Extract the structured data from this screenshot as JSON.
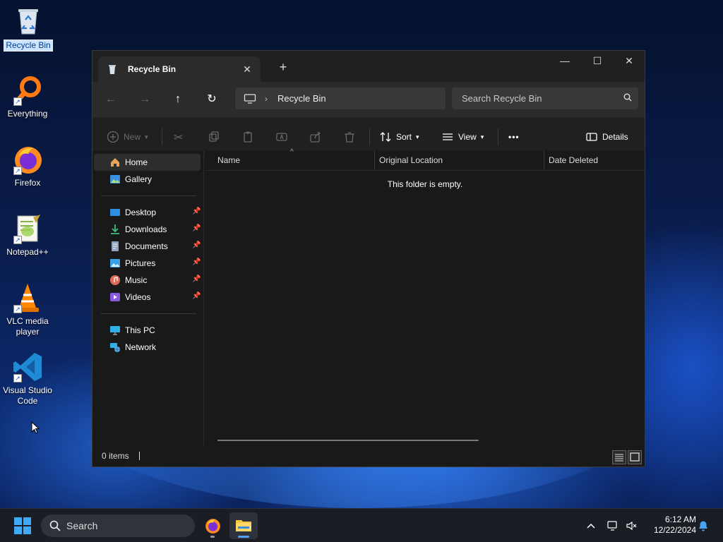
{
  "desktop": {
    "icons": [
      {
        "label": "Recycle Bin",
        "icon": "recycle-bin-icon"
      },
      {
        "label": "Everything",
        "icon": "everything-search-icon"
      },
      {
        "label": "Firefox",
        "icon": "firefox-icon"
      },
      {
        "label": "Notepad++",
        "icon": "notepadpp-icon"
      },
      {
        "label": "VLC media player",
        "icon": "vlc-icon"
      },
      {
        "label": "Visual Studio Code",
        "icon": "vscode-icon"
      }
    ]
  },
  "window": {
    "tab_title": "Recycle Bin",
    "new_tab": "+",
    "controls": {
      "minimize": "—",
      "maximize": "☐",
      "close": "✕"
    },
    "address": {
      "location": "Recycle Bin"
    },
    "search": {
      "placeholder": "Search Recycle Bin"
    },
    "toolbar": {
      "new_label": "New",
      "sort_label": "Sort",
      "view_label": "View",
      "more_label": "•••",
      "details_label": "Details"
    },
    "sidebar": {
      "top": [
        {
          "label": "Home",
          "icon": "home-icon"
        },
        {
          "label": "Gallery",
          "icon": "gallery-icon"
        }
      ],
      "quick_access": [
        {
          "label": "Desktop",
          "icon": "desktop-folder-icon"
        },
        {
          "label": "Downloads",
          "icon": "downloads-folder-icon"
        },
        {
          "label": "Documents",
          "icon": "documents-folder-icon"
        },
        {
          "label": "Pictures",
          "icon": "pictures-folder-icon"
        },
        {
          "label": "Music",
          "icon": "music-folder-icon"
        },
        {
          "label": "Videos",
          "icon": "videos-folder-icon"
        }
      ],
      "locations": [
        {
          "label": "This PC",
          "icon": "this-pc-icon"
        },
        {
          "label": "Network",
          "icon": "network-icon"
        }
      ]
    },
    "columns": [
      "Name",
      "Original Location",
      "Date Deleted"
    ],
    "empty_message": "This folder is empty.",
    "status": {
      "items": "0 items"
    }
  },
  "taskbar": {
    "search_label": "Search",
    "clock": {
      "time": "6:12 AM",
      "date": "12/22/2024"
    },
    "apps": [
      {
        "name": "Firefox",
        "icon": "firefox-icon",
        "active": false
      },
      {
        "name": "File Explorer",
        "icon": "file-explorer-icon",
        "active": true
      }
    ]
  },
  "colors": {
    "accent": "#5aa0f0",
    "window_bg": "#191919",
    "toolbar_bg": "#2b2b2b",
    "taskbar_bg": "#1b1d24"
  }
}
